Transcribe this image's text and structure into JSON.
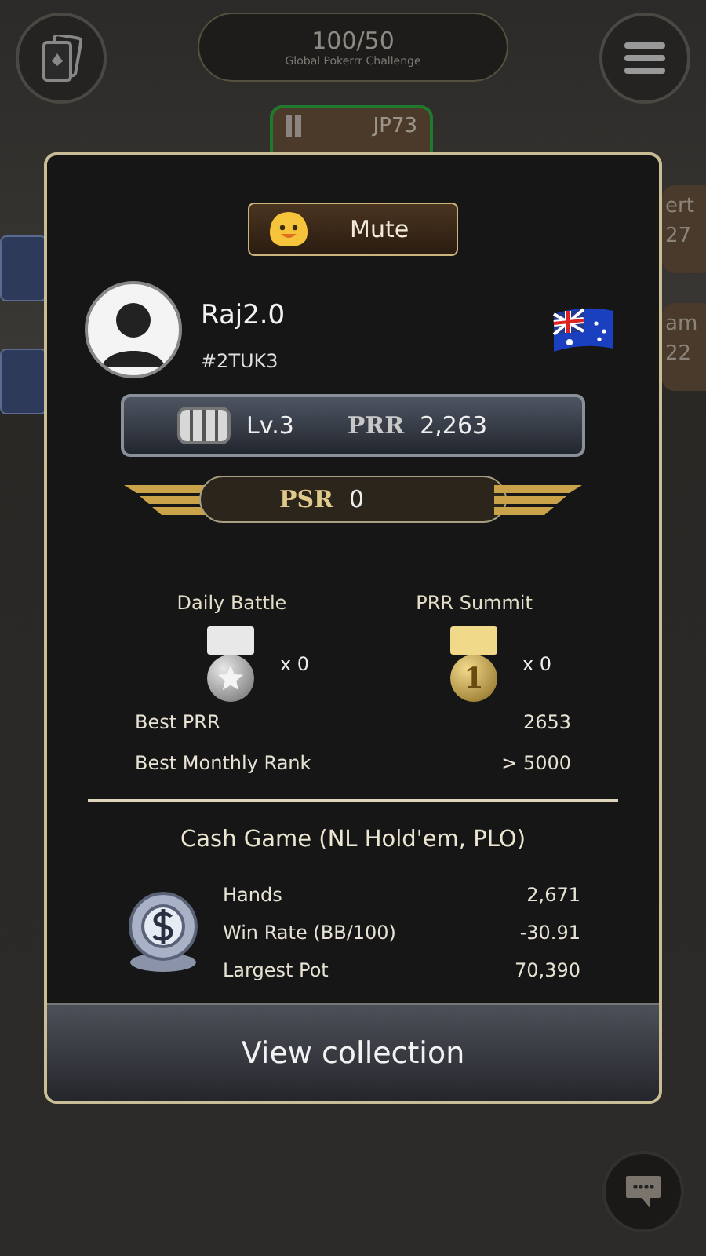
{
  "top_bar": {
    "blinds": "100/50",
    "event": "Global Pokerrr Challenge"
  },
  "seats": [
    {
      "name": "JP73",
      "kind": "top"
    },
    {
      "name": "ert",
      "value": "27",
      "kind": "right"
    },
    {
      "name": "am",
      "value": "22",
      "kind": "right"
    }
  ],
  "profile": {
    "mute_label": "Mute",
    "name": "Raj2.0",
    "tag": "#2TUK3",
    "level": "Lv.3",
    "prr_label": "PRR",
    "prr": "2,263",
    "psr_label": "PSR",
    "psr": "0",
    "medals": [
      {
        "title": "Daily Battle",
        "kind": "silver",
        "count": "x 0"
      },
      {
        "title": "PRR Summit",
        "kind": "gold",
        "mark": "1",
        "count": "x 0"
      }
    ],
    "records": [
      {
        "label": "Best PRR",
        "value": "2653"
      },
      {
        "label": "Best Monthly Rank",
        "value": "> 5000"
      }
    ],
    "cash_game": {
      "title": "Cash Game (NL Hold'em, PLO)",
      "stats": [
        {
          "label": "Hands",
          "value": "2,671"
        },
        {
          "label": "Win Rate (BB/100)",
          "value": "-30.91"
        },
        {
          "label": "Largest Pot",
          "value": "70,390"
        }
      ]
    },
    "button": "View collection"
  }
}
